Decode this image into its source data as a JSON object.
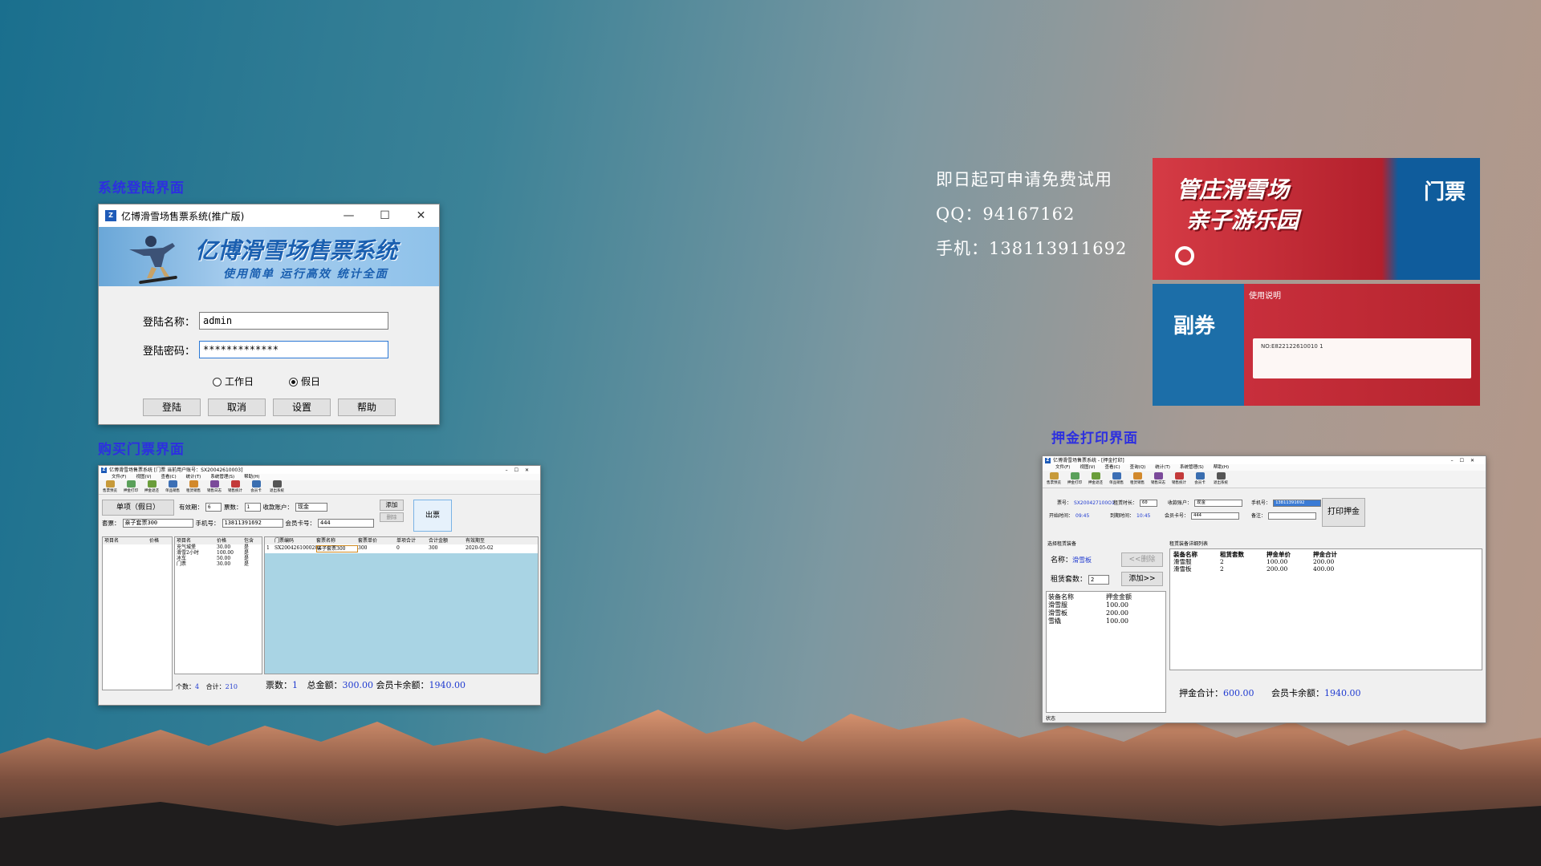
{
  "captions": {
    "login": "系统登陆界面",
    "ticket": "购买门票界面",
    "deposit": "押金打印界面"
  },
  "info": {
    "line1": "即日起可申请免费试用",
    "qq": "QQ：94167162",
    "phone": "手机：13811391169​2"
  },
  "login": {
    "title": "亿博滑雪场售票系统(推广版)",
    "banner_title": "亿博滑雪场售票系统",
    "banner_slogan": "使用简单 运行高效 统计全面",
    "username_label": "登陆名称：",
    "username_value": "admin",
    "password_label": "登陆密码：",
    "password_value": "*************",
    "radio_workday": "工作日",
    "radio_holiday": "假日",
    "btn_login": "登陆",
    "btn_cancel": "取消",
    "btn_settings": "设置",
    "btn_help": "帮助"
  },
  "ticket": {
    "title": "亿博滑雪场售票系统 [门票 当前用户账号：SX20042610003]",
    "menu": [
      "文件(F)",
      "视图(V)",
      "查看(C)",
      "统计(T)",
      "系统管理(S)",
      "帮助(H)"
    ],
    "toolbar": [
      "售票预览",
      "押金打印",
      "押金退还",
      "单品销售",
      "租赁销售",
      "销售日志",
      "销售统计",
      "会员卡",
      "退出系统"
    ],
    "mode_btn": "单项（假日）",
    "valid_label": "有效期：",
    "valid_value": "6",
    "count_label": "票数：",
    "count_value": "1",
    "account_label": "收款账户：",
    "account_value": "现金",
    "btn_add": "添加",
    "btn_delete": "删除",
    "btn_issue": "出票",
    "package_label": "套票：",
    "package_value": "亲子套票300",
    "mobile_label": "手机号：",
    "mobile_value": "13811391692",
    "card_label": "会员卡号：",
    "card_value": "444",
    "left_head": [
      "项目名",
      "价格"
    ],
    "mid_head": [
      "项目名",
      "价格",
      "包含"
    ],
    "mid_rows": [
      [
        "充气城堡",
        "30.00",
        "是"
      ],
      [
        "滑雪2小时",
        "100.00",
        "是"
      ],
      [
        "冰车",
        "50.00",
        "是"
      ],
      [
        "门票",
        "30.00",
        "是"
      ]
    ],
    "right_head": [
      "门票编码",
      "套票名称",
      "套票单价",
      "单项合计",
      "合计金额",
      "有效期至"
    ],
    "right_row": [
      "1",
      "SX200426100020Z",
      "亲子套票300",
      "300",
      "0",
      "300",
      "2020-05-02"
    ],
    "mid_footer_count_label": "个数：",
    "mid_footer_count": "4",
    "mid_footer_sum_label": "合计：",
    "mid_footer_sum": "210",
    "footer_tickets_label": "票数：",
    "footer_tickets": "1",
    "footer_total_label": "总金额：",
    "footer_total": "300.00",
    "footer_balance_label": "会员卡余额：",
    "footer_balance": "1940.00"
  },
  "deposit": {
    "title": "亿博滑雪场售票系统 - [押金打印]",
    "menu": [
      "文件(F)",
      "视图(V)",
      "查看(C)",
      "查询(Q)",
      "统计(T)",
      "系统管理(S)",
      "帮助(H)"
    ],
    "toolbar": [
      "售票预览",
      "押金打印",
      "押金退还",
      "单品销售",
      "租赁销售",
      "销售日志",
      "销售统计",
      "会员卡",
      "退出系统"
    ],
    "ticket_no_label": "票号：",
    "ticket_no": "SX200427100O1",
    "duration_label": "租赁时长：",
    "duration": "60",
    "account_label": "收款账户：",
    "account": "现金",
    "mobile_label": "手机号：",
    "mobile": "13811391692",
    "start_label": "开始时间：",
    "start": "09:45",
    "end_label": "到期时间：",
    "end": "10:45",
    "card_label": "会员卡号：",
    "card": "444",
    "note_label": "备注：",
    "btn_print": "打印押金",
    "select_title": "选择租赁装备",
    "name_label": "名称：",
    "name_value": "滑雪板",
    "qty_label": "租赁套数：",
    "qty_value": "2",
    "btn_remove": "<<删除",
    "btn_add": "添加>>",
    "detail_title": "租赁装备详细列表",
    "detail_head": [
      "装备名称",
      "租赁套数",
      "押金单价",
      "押金合计"
    ],
    "detail_rows": [
      [
        "滑雪服",
        "2",
        "100.00",
        "200.00"
      ],
      [
        "滑雪板",
        "2",
        "200.00",
        "400.00"
      ]
    ],
    "equip_head": [
      "装备名称",
      "押金金额"
    ],
    "equip_rows": [
      [
        "滑雪服",
        "100.00"
      ],
      [
        "滑雪板",
        "200.00"
      ],
      [
        "雪橇",
        "100.00"
      ]
    ],
    "sum_label": "押金合计：",
    "sum": "600.00",
    "balance_label": "会员卡余额：",
    "balance": "1940.00",
    "status": "状态"
  },
  "ticket_images": {
    "front_title": "管庄滑雪场",
    "front_sub": "亲子游乐园",
    "front_side": "门票",
    "back_side": "副券",
    "back_title": "使用说明",
    "back_no": "NO:E822122610010 1"
  },
  "colors": {
    "caption": "#2d2fe0",
    "banner": "#8fc2ea",
    "ticket_red": "#c82f3c",
    "ticket_blue": "#1a66a8"
  }
}
